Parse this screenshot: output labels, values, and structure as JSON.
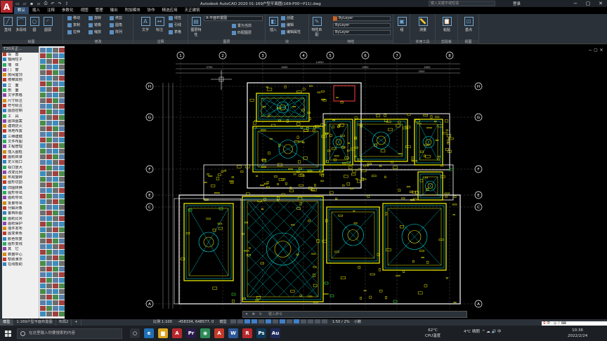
{
  "window": {
    "title": "Autodesk AutoCAD 2020   01-169户型平面图(169-P00~P11).dwg",
    "logo": "A"
  },
  "quick_access": [
    "new-icon",
    "open-icon",
    "save-icon",
    "saveas-icon",
    "print-icon",
    "undo-icon",
    "redo-icon",
    "share-icon"
  ],
  "search": {
    "placeholder": "键入关键字或短语"
  },
  "user": {
    "login": "登录"
  },
  "window_buttons": [
    "−",
    "▢",
    "✕"
  ],
  "menu": [
    {
      "label": "默认",
      "active": true
    },
    {
      "label": "插入"
    },
    {
      "label": "注释"
    },
    {
      "label": "参数化"
    },
    {
      "label": "视图"
    },
    {
      "label": "管理"
    },
    {
      "label": "输出"
    },
    {
      "label": "附加模块"
    },
    {
      "label": "协作"
    },
    {
      "label": "精选应用"
    },
    {
      "label": "天正建筑"
    }
  ],
  "ribbon": {
    "draw": {
      "title": "绘图",
      "tools": [
        "直线",
        "多段线",
        "圆",
        "圆弧"
      ]
    },
    "modify": {
      "title": "修改",
      "tools": [
        "移动",
        "旋转",
        "修剪",
        "复制",
        "镜像",
        "圆角",
        "拉伸",
        "缩放",
        "阵列"
      ]
    },
    "annotation": {
      "title": "注释",
      "tools": [
        "文字",
        "标注",
        "线性",
        "引线",
        "表格"
      ]
    },
    "layer": {
      "title": "图层",
      "current": "A-平面布置图",
      "tools": [
        "图层特性",
        "置为当前",
        "匹配图层"
      ]
    },
    "block": {
      "title": "块",
      "tools": [
        "插入",
        "创建",
        "编辑",
        "编辑属性"
      ]
    },
    "properties": {
      "title": "特性",
      "color": "ByLayer",
      "linetype": "ByLayer",
      "lineweight": "ByLayer",
      "tools": [
        "特性匹配"
      ]
    },
    "groups": {
      "title": "组",
      "label": "组"
    },
    "utilities": {
      "title": "实用工具",
      "label": "测量"
    },
    "clipboard": {
      "title": "剪贴板",
      "label": "粘贴"
    },
    "view": {
      "title": "视图",
      "label": "基点"
    }
  },
  "t20": {
    "header": "T20天正...",
    "items": [
      "设　置",
      "轴网柱子",
      "墙　体",
      "门　窗",
      "房间屋顶",
      "楼梯其他",
      "立　面",
      "剖　面",
      "文字表格",
      "尺寸标注",
      "符号标注",
      "图层控制",
      "工　具",
      "图块图案",
      "建筑防火",
      "场地布置",
      "三维建模",
      "文件布图",
      "工程管理",
      "插入图框",
      "图纸目录",
      "定义视口",
      "视口放大",
      "改变比例",
      "布局旋转",
      "图形切割",
      "旧图转换",
      "图形导出",
      "图纸导出",
      "批量导出",
      "分解对象",
      "备档拆图",
      "图纸比对",
      "图纸保护",
      "插件发布",
      "图变单色",
      "颜色恢复",
      "图形变线",
      "其　它",
      "数据中心",
      "帮助演示",
      "在线帮助"
    ]
  },
  "axis_labels": {
    "top": [
      "1",
      "2",
      "3",
      "4",
      "5",
      "6",
      "7",
      "8"
    ],
    "left": [
      "H",
      "G",
      "F",
      "E",
      "C",
      "A"
    ],
    "right": [
      "H",
      "G",
      "F",
      "E",
      "C",
      "A"
    ]
  },
  "dims": {
    "d1": "3750",
    "d2": "4050",
    "d3": "14950",
    "d4": "4000",
    "d5": "3500",
    "d6": "2000"
  },
  "viewport_buttons": [
    "−",
    "▢",
    "✕"
  ],
  "cmdline": {
    "placeholder": "键入命令"
  },
  "layout_tabs": [
    {
      "label": "模型",
      "active": true
    },
    {
      "label": "1:169户型平面布置图"
    },
    {
      "label": "布局2"
    },
    {
      "label": "+"
    }
  ],
  "status": {
    "scale": "比例 1:100",
    "coords": "-458334, 648577, 0",
    "model": "模型",
    "anno_scale": "1:50 / 2%",
    "units": "小数"
  },
  "taskbar": {
    "search_placeholder": "在这里输入你要搜索的内容",
    "apps": [
      {
        "t": "○",
        "c": "#2b2f36"
      },
      {
        "t": "e",
        "c": "#1f6fb5"
      },
      {
        "t": "▆",
        "c": "#d9a520"
      },
      {
        "t": "A",
        "c": "#b7282e"
      },
      {
        "t": "Pr",
        "c": "#2a1a4a"
      },
      {
        "t": "◉",
        "c": "#2e8b57"
      },
      {
        "t": "A",
        "c": "#c23a2a"
      },
      {
        "t": "W",
        "c": "#2b5797"
      },
      {
        "t": "R",
        "c": "#b7282e"
      },
      {
        "t": "Ps",
        "c": "#0f3a5a"
      },
      {
        "t": "Au",
        "c": "#1e2a5a"
      }
    ]
  },
  "weather": {
    "temp": "62°C",
    "label": "CPU温度"
  },
  "tray": {
    "weather": "4°C 晴朗",
    "icons": "^ ☁ 🔊 中"
  },
  "clock": {
    "time": "10:36",
    "date": "2022/2/24"
  },
  "ime": {
    "brand": "S",
    "label": "中 · ◎ ♪ ⌨"
  },
  "colors": {
    "bg": "#000000",
    "ribbon": "#2b3138",
    "plan_wall": "#ffffff",
    "plan_fixture": "#e6e600",
    "plan_detail": "#00e6e6",
    "plan_hatch": "#ff3b3b",
    "plan_green": "#3ad13a",
    "dim": "#cccccc"
  }
}
